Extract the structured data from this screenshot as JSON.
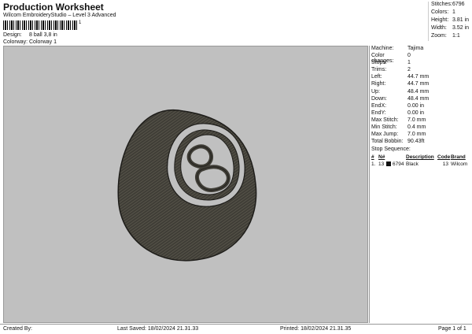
{
  "header": {
    "title": "Production Worksheet",
    "subtitle": "Wilcom EmbroideryStudio – Level 3 Advanced",
    "barcode_text": "1"
  },
  "meta": {
    "design_label": "Design:",
    "design_value": "8 ball 3,8 in",
    "colorway_label": "Colorway:",
    "colorway_value": "Colorway 1"
  },
  "stats": [
    {
      "label": "Stitches:",
      "value": "6796"
    },
    {
      "label": "Colors:",
      "value": "1"
    },
    {
      "label": "Height:",
      "value": "3.81 in"
    },
    {
      "label": "Width:",
      "value": "3.52 in"
    },
    {
      "label": "Zoom:",
      "value": "1:1"
    }
  ],
  "properties": [
    {
      "label": "Machine:",
      "value": "Tajima"
    },
    {
      "label": "Color changes:",
      "value": "0"
    },
    {
      "label": "Stops:",
      "value": "1"
    },
    {
      "label": "Trims:",
      "value": "2"
    },
    {
      "label": "Left:",
      "value": "44.7 mm"
    },
    {
      "label": "Right:",
      "value": "44.7 mm"
    },
    {
      "label": "Up:",
      "value": "48.4 mm"
    },
    {
      "label": "Down:",
      "value": "48.4 mm"
    },
    {
      "label": "EndX:",
      "value": "0.00 in"
    },
    {
      "label": "EndY:",
      "value": "0.00 in"
    },
    {
      "label": "Max Stitch:",
      "value": "7.0 mm"
    },
    {
      "label": "Min Stitch:",
      "value": "0.4 mm"
    },
    {
      "label": "Max Jump:",
      "value": "7.0 mm"
    },
    {
      "label": "Total Bobbin:",
      "value": "90.43ft"
    }
  ],
  "stop_sequence": {
    "title": "Stop Sequence:",
    "headers": [
      "#",
      "N#",
      "",
      "",
      "Description",
      "Code",
      "Brand"
    ],
    "rows": [
      {
        "index": "1.",
        "needle": "13",
        "stitches": "6794",
        "description": "Black",
        "code": "13",
        "brand": "Wilcom",
        "color": "#111111"
      }
    ]
  },
  "footer": {
    "created_by": "Created By:",
    "last_saved": "Last Saved: 18/02/2024 21.31.33",
    "printed": "Printed: 18/02/2024 21.31.35",
    "page": "Page 1 of 1"
  },
  "colors": {
    "canvas": "#c0c0c0",
    "thread": "#3f3d36"
  },
  "icons": [
    "8-ball-embroidery-design"
  ]
}
